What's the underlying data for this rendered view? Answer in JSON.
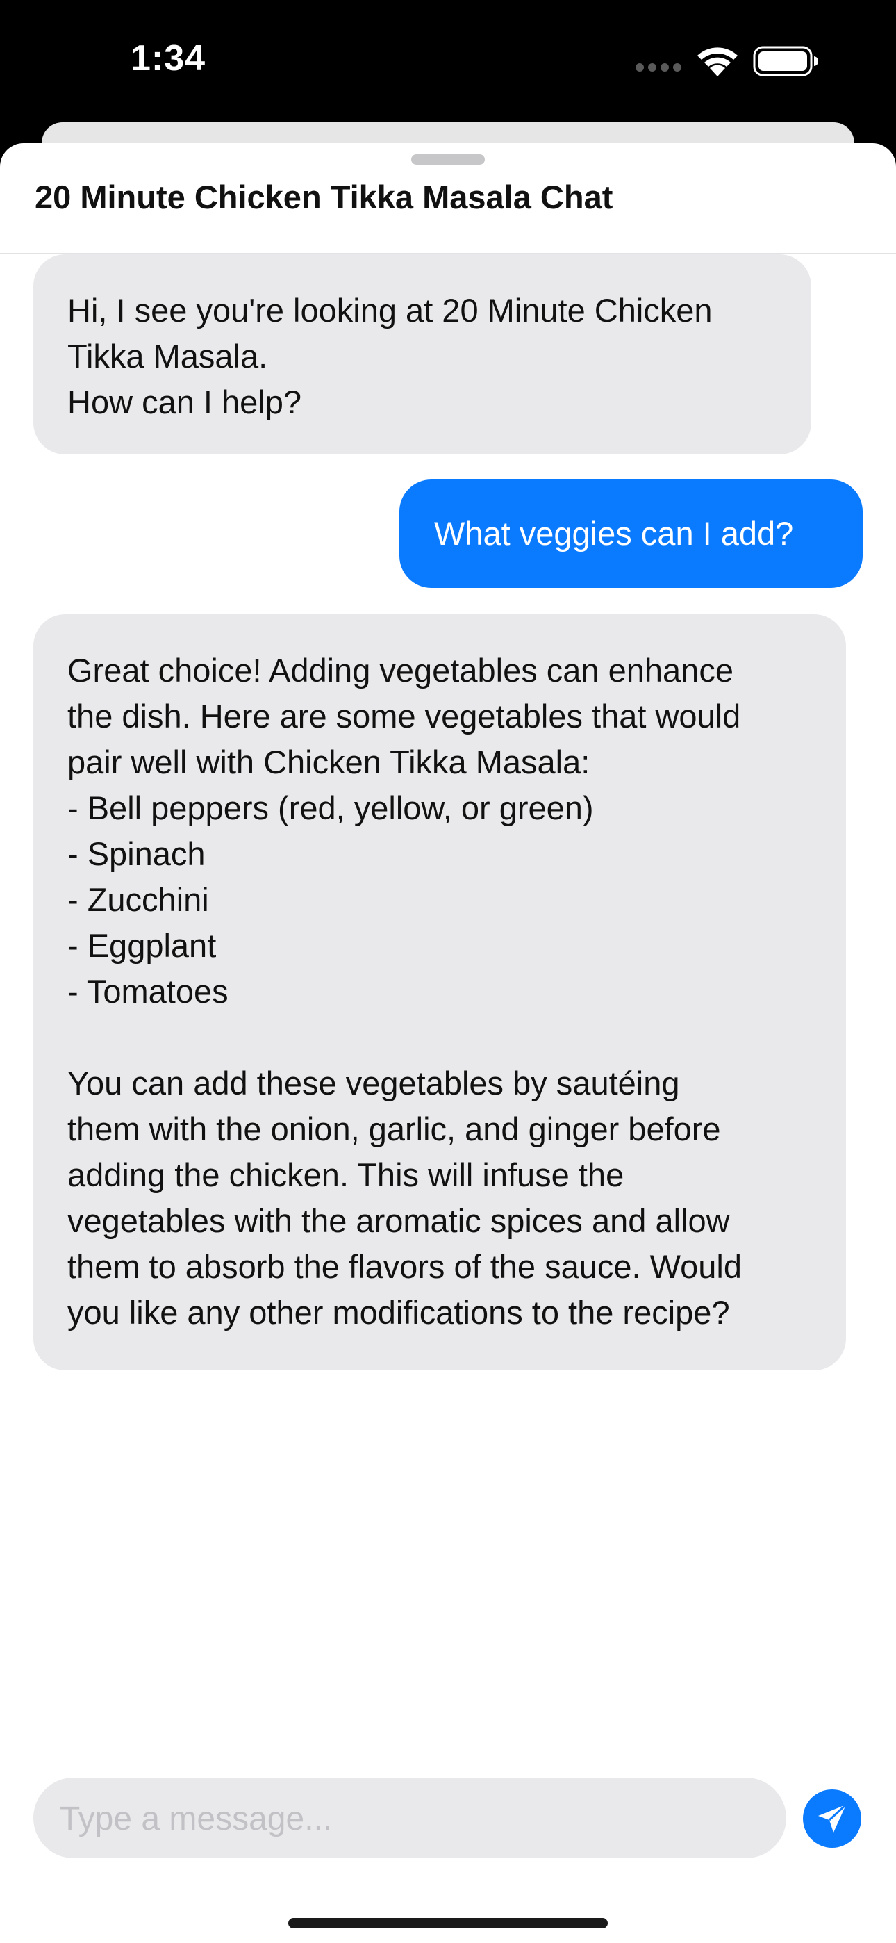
{
  "status_bar": {
    "time": "1:34"
  },
  "chat": {
    "title": "20 Minute Chicken Tikka Masala Chat",
    "messages": [
      {
        "role": "assistant",
        "text": "Hi, I see you're looking at 20 Minute Chicken\nTikka Masala.\nHow can I help?"
      },
      {
        "role": "user",
        "text": "What veggies can I add?"
      },
      {
        "role": "assistant",
        "text": "Great choice! Adding vegetables can enhance\nthe dish. Here are some vegetables that would\npair well with Chicken Tikka Masala:\n- Bell peppers (red, yellow, or green)\n- Spinach\n- Zucchini\n- Eggplant\n- Tomatoes\n\nYou can add these vegetables by sautéing\nthem with the onion, garlic, and ginger before\nadding the chicken. This will infuse the\nvegetables with the aromatic spices and allow\nthem to absorb the flavors of the sauce. Would\nyou like any other modifications to the recipe?"
      }
    ]
  },
  "composer": {
    "placeholder": "Type a message...",
    "send_icon": "paper-plane-icon"
  },
  "colors": {
    "accent": "#0a7bff",
    "bubble_gray": "#e9e9eb"
  }
}
